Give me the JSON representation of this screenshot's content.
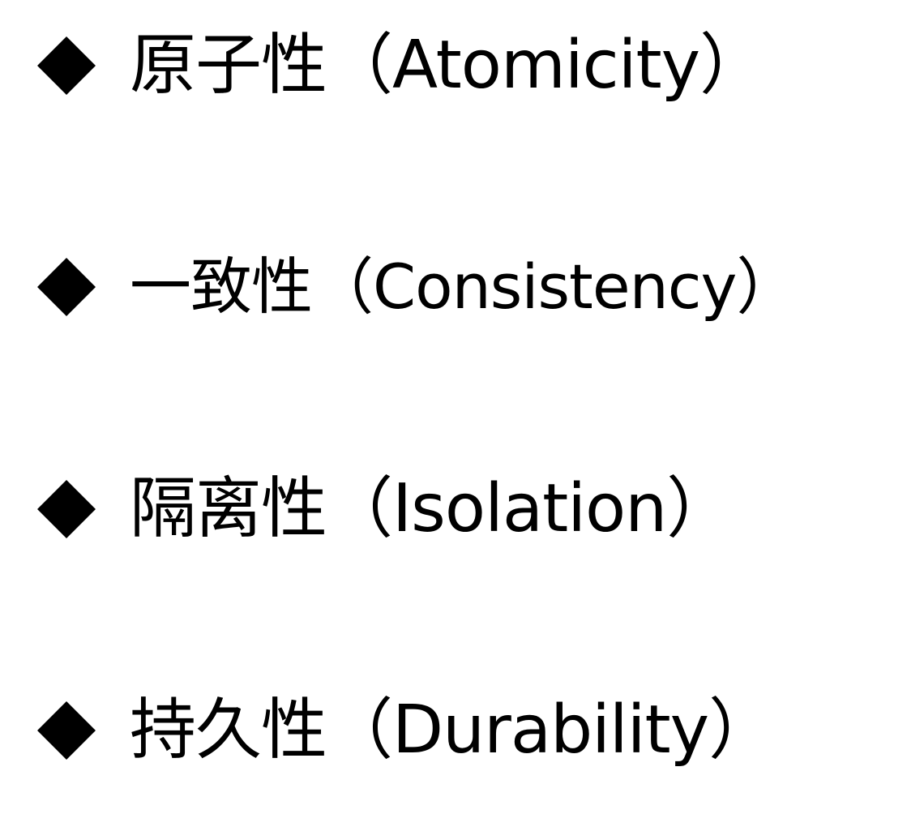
{
  "bullet_icon": "black-diamond-icon",
  "items": [
    {
      "text": "原子性（Atomicity）"
    },
    {
      "text": "一致性（Consistency）"
    },
    {
      "text": "隔离性（Isolation）"
    },
    {
      "text": "持久性（Durability）"
    }
  ]
}
